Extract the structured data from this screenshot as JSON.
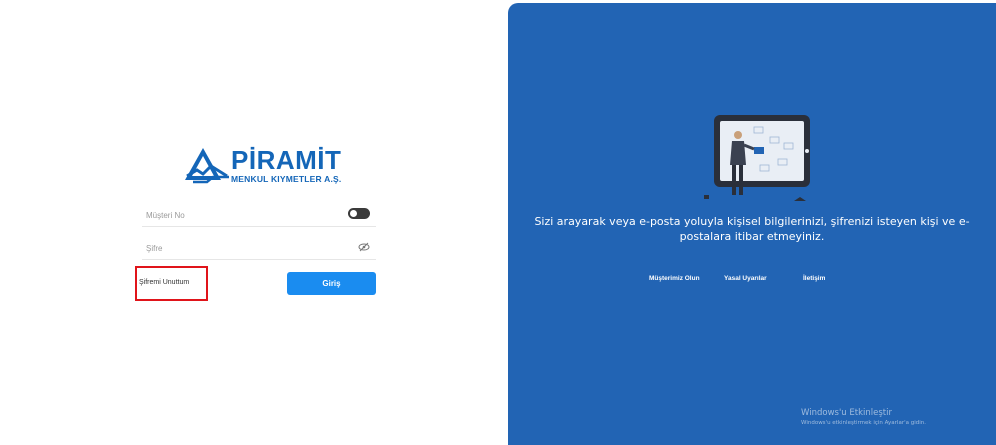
{
  "brand": {
    "name": "PİRAMİT",
    "subtitle": "MENKUL KIYMETLER A.Ş.",
    "color": "#1466b8"
  },
  "login_form": {
    "customer_no_placeholder": "Müşteri No",
    "password_placeholder": "Şifre",
    "forgot_password_label": "Şifremi Unuttum",
    "login_button_label": "Giriş",
    "button_color": "#1a8cf0",
    "highlight_color": "#e0141a"
  },
  "info_panel": {
    "background": "#2264b4",
    "warning_text": "Sizi arayarak veya e-posta yoluyla kişisel bilgilerinizi, şifrenizi isteyen kişi ve e-postalara itibar etmeyiniz.",
    "links": {
      "become_customer": "Müşterimiz Olun",
      "legal_warnings": "Yasal Uyarılar",
      "contact": "İletişim"
    }
  },
  "windows_activation": {
    "title": "Windows'u Etkinleştir",
    "subtitle": "Windows'u etkinleştirmek için Ayarlar'a gidin."
  }
}
